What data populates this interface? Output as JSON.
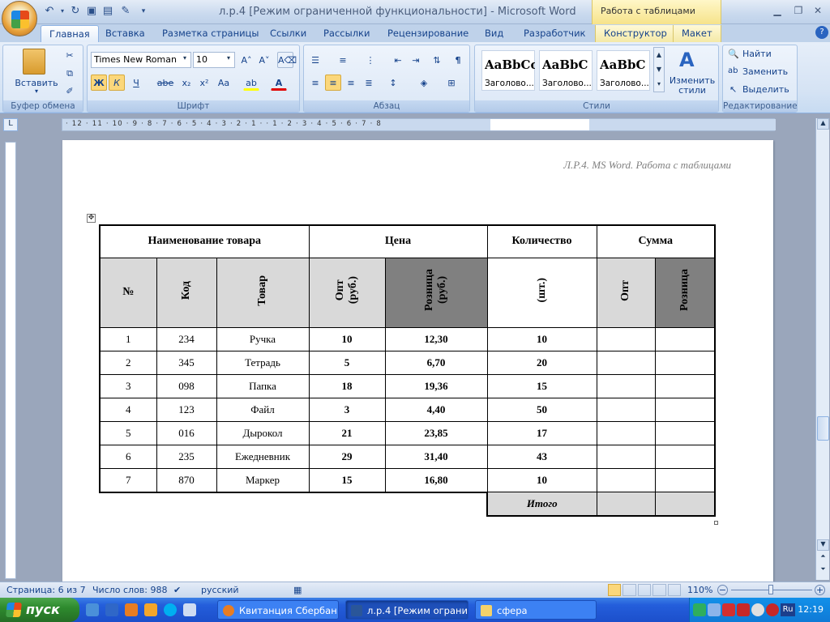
{
  "window": {
    "title": "л.р.4 [Режим ограниченной функциональности] - Microsoft Word",
    "context_group": "Работа с таблицами"
  },
  "tabs": [
    "Главная",
    "Вставка",
    "Разметка страницы",
    "Ссылки",
    "Рассылки",
    "Рецензирование",
    "Вид",
    "Разработчик",
    "Конструктор",
    "Макет"
  ],
  "ribbon": {
    "clipboard": {
      "paste_label": "Вставить",
      "group": "Буфер обмена"
    },
    "font": {
      "name": "Times New Roman",
      "size": "10",
      "group": "Шрифт",
      "bold": "Ж",
      "italic": "К",
      "underline": "Ч",
      "strike": "abe",
      "sub": "x₂",
      "sup": "x²",
      "case": "Aa"
    },
    "paragraph": {
      "group": "Абзац"
    },
    "styles": {
      "group": "Стили",
      "items": [
        {
          "sample": "AaBbCcI",
          "name": "Заголово..."
        },
        {
          "sample": "AaBbC",
          "name": "Заголово..."
        },
        {
          "sample": "AaBbC",
          "name": "Заголово..."
        }
      ],
      "change_styles": "Изменить стили"
    },
    "editing": {
      "group": "Редактирование",
      "find": "Найти",
      "replace": "Заменить",
      "select": "Выделить"
    }
  },
  "ruler": {
    "labels": "· 12 · 11 · 10 · 9 · 8 · 7 · 6 · 5 · 4 · 3 · 2 · 1 ·    · 1 · 2 · 3 · 4 · 5 · 6 · 7 · 8"
  },
  "document": {
    "header_text": "Л.Р.4. MS Word. Работа с таблицами",
    "table": {
      "group_headers": [
        "Наименование товара",
        "Цена",
        "Количество",
        "Сумма"
      ],
      "sub_headers": [
        "№",
        "Код",
        "Товар",
        "Опт (руб.)",
        "Розница (руб.)",
        "(шт.)",
        "Опт",
        "Розница"
      ],
      "sub_headers_opt_line1": "Опт",
      "sub_headers_opt_line2": "(руб.)",
      "sub_headers_ret_line1": "Розница",
      "sub_headers_ret_line2": "(руб.)",
      "rows": [
        {
          "n": "1",
          "code": "234",
          "item": "Ручка",
          "opt": "10",
          "retail": "12,30",
          "qty": "10"
        },
        {
          "n": "2",
          "code": "345",
          "item": "Тетрадь",
          "opt": "5",
          "retail": "6,70",
          "qty": "20"
        },
        {
          "n": "3",
          "code": "098",
          "item": "Папка",
          "opt": "18",
          "retail": "19,36",
          "qty": "15"
        },
        {
          "n": "4",
          "code": "123",
          "item": "Файл",
          "opt": "3",
          "retail": "4,40",
          "qty": "50"
        },
        {
          "n": "5",
          "code": "016",
          "item": "Дырокол",
          "opt": "21",
          "retail": "23,85",
          "qty": "17"
        },
        {
          "n": "6",
          "code": "235",
          "item": "Ежедневник",
          "opt": "29",
          "retail": "31,40",
          "qty": "43"
        },
        {
          "n": "7",
          "code": "870",
          "item": "Маркер",
          "opt": "15",
          "retail": "16,80",
          "qty": "10"
        }
      ],
      "total_label": "Итого"
    }
  },
  "statusbar": {
    "page": "Страница: 6 из 7",
    "words": "Число слов: 988",
    "language": "русский",
    "zoom": "110%"
  },
  "taskbar": {
    "start": "пуск",
    "tasks": [
      "Квитанция Сбербан...",
      "л.р.4 [Режим ограни...",
      "сфера"
    ],
    "lang": "Ru",
    "clock": "12:19"
  },
  "colors": {
    "ribbon_bg": "#d5e3f4",
    "header_gray": "#d9d9d9",
    "header_dark": "#808080",
    "taskbar": "#245edb",
    "start": "#2e8b2e"
  }
}
